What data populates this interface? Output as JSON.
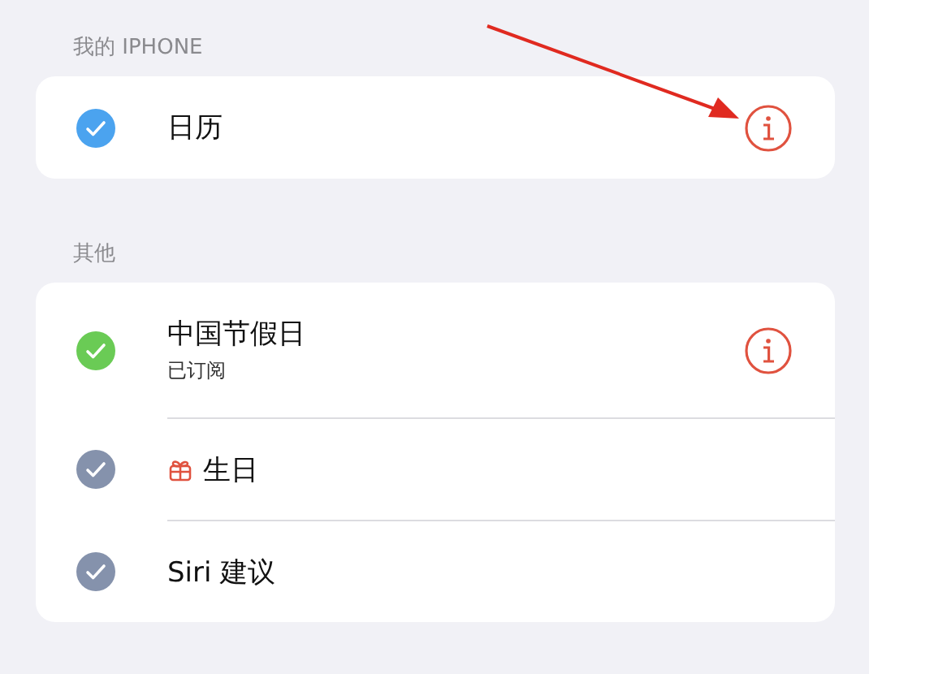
{
  "sections": [
    {
      "header": "我的 IPHONE",
      "items": [
        {
          "kind": "calendar",
          "name": "日历",
          "checked": true,
          "color": "#4ba3ef",
          "info": true
        }
      ]
    },
    {
      "header": "其他",
      "items": [
        {
          "kind": "calendar",
          "name": "中国节假日",
          "subtitle": "已订阅",
          "checked": true,
          "color": "#6acb55",
          "info": true
        },
        {
          "kind": "birthday",
          "name": "生日",
          "checked": true,
          "color": "#8592ac",
          "info": false
        },
        {
          "kind": "calendar",
          "name": "Siri 建议",
          "checked": true,
          "color": "#8592ac",
          "info": false
        }
      ]
    }
  ]
}
